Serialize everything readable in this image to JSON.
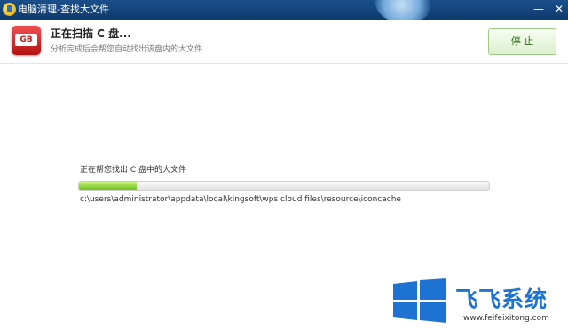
{
  "window": {
    "title": "电脑清理-查找大文件",
    "minimize_glyph": "—",
    "close_glyph": "✕"
  },
  "header": {
    "icon_label": "GB",
    "title": "正在扫描 C 盘...",
    "subtitle": "分析完成后会帮您自动找出该盘内的大文件",
    "stop_button": "停 止"
  },
  "scan": {
    "status": "正在帮您找出 C 盘中的大文件",
    "progress": 0.14,
    "current_path": "c:\\users\\administrator\\appdata\\local\\kingsoft\\wps cloud files\\resource\\iconcache"
  },
  "watermark": {
    "brand": "飞飞系统",
    "url": "www.feifeixitong.com"
  },
  "colors": {
    "titlebar": "#1a4f8c",
    "progress_fill": "#6ec21c",
    "brand_blue": "#1e73d2"
  }
}
